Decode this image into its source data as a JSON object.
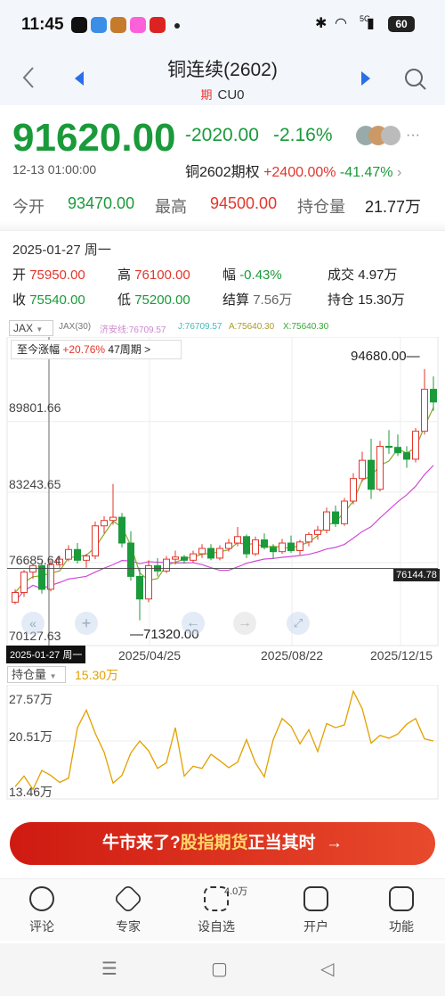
{
  "status": {
    "time": "11:45",
    "battery": "60",
    "network": "5G"
  },
  "header": {
    "title": "铜连续(2602)",
    "sub_tag": "期",
    "sub_code": "CU0"
  },
  "quote": {
    "price": "91620.00",
    "change": "-2020.00",
    "change_pct": "-2.16%",
    "timestamp": "12-13 01:00:00",
    "option_label": "铜2602期权",
    "option_up": "+2400.00%",
    "option_down": "-41.47%"
  },
  "stats": {
    "row1": [
      {
        "label": "今开",
        "value": "93470.00"
      },
      {
        "label": "最高",
        "value": "94500.00"
      },
      {
        "label": "持仓量",
        "value": "21.77万"
      }
    ]
  },
  "candle_detail": {
    "date": "2025-01-27 周一",
    "open_label": "开",
    "open": "75950.00",
    "high_label": "高",
    "high": "76100.00",
    "amp_label": "幅",
    "amp": "-0.43%",
    "vol_label": "成交",
    "vol": "4.97万",
    "close_label": "收",
    "close": "75540.00",
    "low_label": "低",
    "low": "75200.00",
    "settle_label": "结算",
    "settle": "7.56万",
    "oi_label": "持仓",
    "oi": "15.30万"
  },
  "indicators": {
    "dropdown": "JAX",
    "jax": "JAX(30)",
    "jiaan": "济安线:76709.57",
    "j": "J:76709.57",
    "a": "A:75640.30",
    "x": "X:75640.30"
  },
  "since": {
    "label": "至今涨幅",
    "value": "+20.76%",
    "period": "47周期 >"
  },
  "chart_data": {
    "type": "candlestick",
    "y_ticks": [
      "89801.66",
      "83243.65",
      "76685.64",
      "70127.63"
    ],
    "x_ticks": [
      "2025/04/25",
      "2025/08/22",
      "2025/12/15"
    ],
    "max_label": "94680.00",
    "min_label": "71320.00",
    "last_tag": "76144.78",
    "tooltip_date": "2025-01-27 周一",
    "ylim": [
      70127.63,
      96000
    ],
    "candles": [
      [
        73000,
        74200,
        72800,
        73900
      ],
      [
        73900,
        76000,
        73500,
        75800
      ],
      [
        75800,
        76600,
        75200,
        76400
      ],
      [
        76400,
        76800,
        73800,
        74200
      ],
      [
        74200,
        76900,
        74000,
        76500
      ],
      [
        76500,
        77300,
        76200,
        77000
      ],
      [
        77000,
        78300,
        76800,
        77900
      ],
      [
        77900,
        78500,
        76600,
        76900
      ],
      [
        76900,
        77500,
        76200,
        77300
      ],
      [
        77300,
        80500,
        77000,
        80100
      ],
      [
        80100,
        81000,
        79400,
        80600
      ],
      [
        80600,
        84000,
        80200,
        80900
      ],
      [
        80900,
        81300,
        78100,
        78500
      ],
      [
        78500,
        79600,
        75000,
        75400
      ],
      [
        75400,
        76200,
        71320,
        73300
      ],
      [
        73300,
        76900,
        73000,
        76400
      ],
      [
        76400,
        77100,
        75400,
        75900
      ],
      [
        75900,
        77300,
        75700,
        77000
      ],
      [
        77000,
        77800,
        76500,
        77200
      ],
      [
        77200,
        77400,
        76600,
        76900
      ],
      [
        76900,
        77800,
        76700,
        77500
      ],
      [
        77500,
        78400,
        77100,
        78000
      ],
      [
        78000,
        78400,
        76900,
        77100
      ],
      [
        77100,
        78300,
        76900,
        78000
      ],
      [
        78000,
        78900,
        77700,
        78500
      ],
      [
        78500,
        80000,
        78200,
        79100
      ],
      [
        79100,
        79300,
        77100,
        77500
      ],
      [
        77500,
        79100,
        77300,
        78800
      ],
      [
        78800,
        79400,
        77900,
        78100
      ],
      [
        78100,
        78400,
        77000,
        77700
      ],
      [
        77700,
        78900,
        77500,
        78500
      ],
      [
        78500,
        79200,
        77600,
        77800
      ],
      [
        77800,
        78800,
        77400,
        78600
      ],
      [
        78600,
        79500,
        78200,
        79300
      ],
      [
        79300,
        80100,
        78800,
        79700
      ],
      [
        79700,
        81800,
        79400,
        81400
      ],
      [
        81400,
        82000,
        80000,
        80300
      ],
      [
        80300,
        82700,
        80100,
        82400
      ],
      [
        82400,
        85000,
        82100,
        84500
      ],
      [
        84500,
        87000,
        84200,
        86200
      ],
      [
        86200,
        88200,
        82600,
        83500
      ],
      [
        83500,
        88000,
        83300,
        87500
      ],
      [
        87500,
        89000,
        86800,
        87400
      ],
      [
        87400,
        88600,
        86600,
        86900
      ],
      [
        86900,
        87500,
        85500,
        86300
      ],
      [
        86300,
        89200,
        86000,
        88900
      ],
      [
        88900,
        94680,
        88600,
        92800
      ],
      [
        92800,
        94000,
        90800,
        91620
      ]
    ],
    "oi_ticks": [
      "27.57万",
      "20.51万",
      "13.46万"
    ],
    "oi_series": [
      14.0,
      15.5,
      13.6,
      16.3,
      15.6,
      14.6,
      15.2,
      22.4,
      24.9,
      21.6,
      18.9,
      14.5,
      15.6,
      18.8,
      20.5,
      19.1,
      16.6,
      17.4,
      22.4,
      15.5,
      16.9,
      16.6,
      18.6,
      17.7,
      16.7,
      17.5,
      20.7,
      17.4,
      15.4,
      20.7,
      23.7,
      22.6,
      20.1,
      22.1,
      19.0,
      23.0,
      22.4,
      22.8,
      27.6,
      25.1,
      20.2,
      21.3,
      20.9,
      21.5,
      22.9,
      23.7,
      20.8,
      20.5
    ]
  },
  "oi_panel": {
    "dropdown": "持仓量",
    "value": "15.30万"
  },
  "banner": {
    "part1": "牛市来了?",
    "part2": "股指期货",
    "part3": "正当其时",
    "arrow": "→"
  },
  "toolbar": [
    {
      "label": "评论"
    },
    {
      "label": "专家"
    },
    {
      "label": "设自选",
      "badge": "4.0万"
    },
    {
      "label": "开户"
    },
    {
      "label": "功能"
    }
  ]
}
